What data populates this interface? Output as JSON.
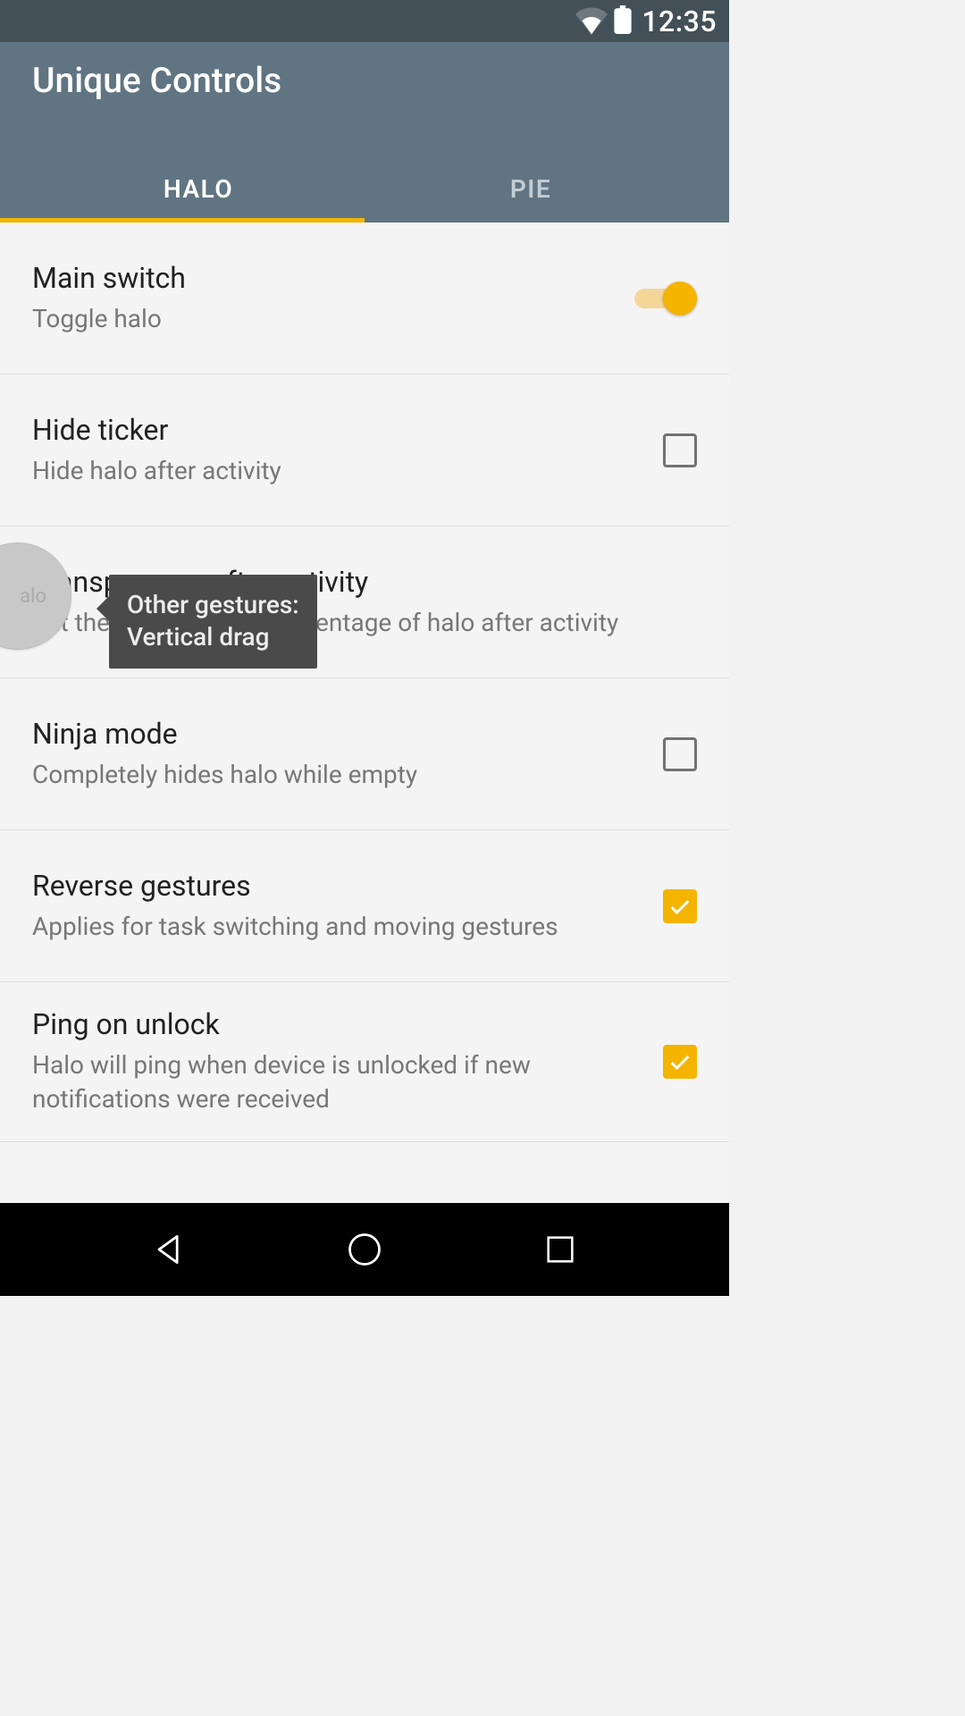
{
  "status": {
    "clock": "12:35"
  },
  "header": {
    "title": "Unique Controls"
  },
  "tabs": [
    {
      "label": "HALO",
      "active": true
    },
    {
      "label": "PIE",
      "active": false
    }
  ],
  "settings": {
    "items": [
      {
        "title": "Main switch",
        "subtitle": "Toggle halo",
        "control": "switch",
        "value": true
      },
      {
        "title": "Hide ticker",
        "subtitle": "Hide halo after activity",
        "control": "checkbox",
        "value": false
      },
      {
        "title": "Transparency after activity",
        "subtitle": "Set the transparency percentage of halo after activity",
        "control": "none"
      },
      {
        "title": "Ninja mode",
        "subtitle": "Completely hides halo while empty",
        "control": "checkbox",
        "value": false
      },
      {
        "title": "Reverse gestures",
        "subtitle": "Applies for task switching and moving gestures",
        "control": "checkbox",
        "value": true
      },
      {
        "title": "Ping on unlock",
        "subtitle": "Halo will ping when device is unlocked if new notifications were received",
        "control": "checkbox",
        "value": true
      }
    ]
  },
  "halo_bubble": {
    "text": "alo"
  },
  "tooltip": {
    "line1": "Other gestures:",
    "line2": "Vertical drag"
  }
}
